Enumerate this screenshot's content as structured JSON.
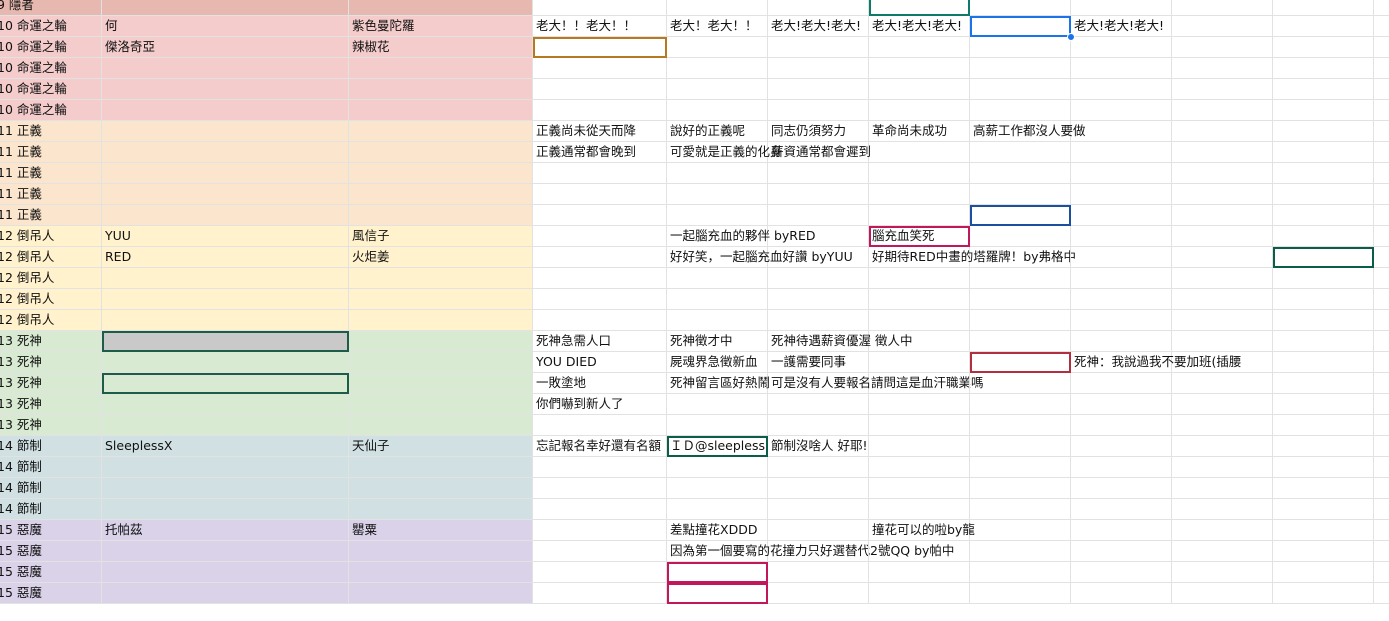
{
  "colors": {
    "hermit": "#e6b8af",
    "wheel": "#f4cccc",
    "justice": "#fce5cd",
    "hanged": "#fff2cc",
    "death": "#d9ead3",
    "temperance": "#d0e0e3",
    "devil": "#d9d2e9",
    "grid": "#e2e2e2",
    "selection_blue": "#1a73e8"
  },
  "rows": [
    {
      "group": "hermit",
      "cells": [
        "9 隱者",
        "",
        "",
        "",
        "",
        "",
        "",
        "",
        "",
        "",
        "",
        ""
      ]
    },
    {
      "group": "wheel",
      "cells": [
        "10 命運之輪",
        "何",
        "紫色曼陀羅",
        "老大！！老大！！",
        "老大！老大！！",
        "老大!老大!老大!",
        "老大!老大!老大!",
        "",
        "老大!老大!老大!",
        "",
        "",
        ""
      ]
    },
    {
      "group": "wheel",
      "cells": [
        "10 命運之輪",
        "傑洛奇亞",
        "辣椒花",
        "",
        "",
        "",
        "",
        "",
        "",
        "",
        "",
        ""
      ]
    },
    {
      "group": "wheel",
      "cells": [
        "10 命運之輪",
        "",
        "",
        "",
        "",
        "",
        "",
        "",
        "",
        "",
        "",
        ""
      ]
    },
    {
      "group": "wheel",
      "cells": [
        "10 命運之輪",
        "",
        "",
        "",
        "",
        "",
        "",
        "",
        "",
        "",
        "",
        ""
      ]
    },
    {
      "group": "wheel",
      "cells": [
        "10 命運之輪",
        "",
        "",
        "",
        "",
        "",
        "",
        "",
        "",
        "",
        "",
        ""
      ]
    },
    {
      "group": "justice",
      "cells": [
        "11 正義",
        "",
        "",
        "正義尚未從天而降",
        "說好的正義呢",
        "同志仍須努力",
        "革命尚未成功",
        "高薪工作都沒人要做",
        "",
        "",
        "",
        ""
      ]
    },
    {
      "group": "justice",
      "cells": [
        "11 正義",
        "",
        "",
        "正義通常都會晚到",
        "可愛就是正義的化身",
        "薪資通常都會遲到",
        "",
        "",
        "",
        "",
        "",
        ""
      ]
    },
    {
      "group": "justice",
      "cells": [
        "11 正義",
        "",
        "",
        "",
        "",
        "",
        "",
        "",
        "",
        "",
        "",
        ""
      ]
    },
    {
      "group": "justice",
      "cells": [
        "11 正義",
        "",
        "",
        "",
        "",
        "",
        "",
        "",
        "",
        "",
        "",
        ""
      ]
    },
    {
      "group": "justice",
      "cells": [
        "11 正義",
        "",
        "",
        "",
        "",
        "",
        "",
        "",
        "",
        "",
        "",
        ""
      ]
    },
    {
      "group": "hanged",
      "cells": [
        "12 倒吊人",
        "YUU",
        "風信子",
        "",
        "一起腦充血的夥伴 byRED",
        "",
        "腦充血笑死",
        "",
        "",
        "",
        "",
        ""
      ]
    },
    {
      "group": "hanged",
      "cells": [
        "12 倒吊人",
        "RED",
        "火炬姜",
        "",
        "好好笑，一起腦充血好讚 byYUU",
        "",
        "好期待RED中畫的塔羅牌！by弗格中",
        "",
        "",
        "",
        "",
        ""
      ]
    },
    {
      "group": "hanged",
      "cells": [
        "12 倒吊人",
        "",
        "",
        "",
        "",
        "",
        "",
        "",
        "",
        "",
        "",
        ""
      ]
    },
    {
      "group": "hanged",
      "cells": [
        "12 倒吊人",
        "",
        "",
        "",
        "",
        "",
        "",
        "",
        "",
        "",
        "",
        ""
      ]
    },
    {
      "group": "hanged",
      "cells": [
        "12 倒吊人",
        "",
        "",
        "",
        "",
        "",
        "",
        "",
        "",
        "",
        "",
        ""
      ]
    },
    {
      "group": "death",
      "cells": [
        "13 死神",
        "",
        "",
        "死神急需人口",
        "死神徵才中",
        "死神待遇薪資優渥 徵人中",
        "",
        "",
        "",
        "",
        "",
        ""
      ]
    },
    {
      "group": "death",
      "cells": [
        "13 死神",
        "",
        "",
        "YOU DIED",
        "屍魂界急徵新血",
        "一護需要同事",
        "",
        "",
        "死神：我說過我不要加班(插腰",
        "",
        "",
        ""
      ]
    },
    {
      "group": "death",
      "cells": [
        "13 死神",
        "",
        "",
        "一敗塗地",
        "死神留言區好熱鬧",
        "可是沒有人要報名請問這是血汗職業嗎",
        "",
        "",
        "",
        "",
        "",
        ""
      ]
    },
    {
      "group": "death",
      "cells": [
        "13 死神",
        "",
        "",
        "你們嚇到新人了",
        "",
        "",
        "",
        "",
        "",
        "",
        "",
        ""
      ]
    },
    {
      "group": "death",
      "cells": [
        "13 死神",
        "",
        "",
        "",
        "",
        "",
        "",
        "",
        "",
        "",
        "",
        ""
      ]
    },
    {
      "group": "temperance",
      "cells": [
        "14 節制",
        "SleeplessX",
        "天仙子",
        "忘記報名幸好還有名額",
        "ＩＤ@sleepless",
        "節制沒啥人 好耶!",
        "",
        "",
        "",
        "",
        "",
        ""
      ]
    },
    {
      "group": "temperance",
      "cells": [
        "14 節制",
        "",
        "",
        "",
        "",
        "",
        "",
        "",
        "",
        "",
        "",
        ""
      ]
    },
    {
      "group": "temperance",
      "cells": [
        "14 節制",
        "",
        "",
        "",
        "",
        "",
        "",
        "",
        "",
        "",
        "",
        ""
      ]
    },
    {
      "group": "temperance",
      "cells": [
        "14 節制",
        "",
        "",
        "",
        "",
        "",
        "",
        "",
        "",
        "",
        "",
        ""
      ]
    },
    {
      "group": "devil",
      "cells": [
        "15 惡魔",
        "托帕茲",
        "罌粟",
        "",
        "差點撞花XDDD",
        "",
        "撞花可以的啦by龍",
        "",
        "",
        "",
        "",
        ""
      ]
    },
    {
      "group": "devil",
      "cells": [
        "15 惡魔",
        "",
        "",
        "",
        "因為第一個要寫的花撞力只好選替代2號QQ  by帕中",
        "",
        "",
        "",
        "",
        "",
        "",
        ""
      ]
    },
    {
      "group": "devil",
      "cells": [
        "15 惡魔",
        "",
        "",
        "",
        "",
        "",
        "",
        "",
        "",
        "",
        "",
        ""
      ]
    },
    {
      "group": "devil",
      "cells": [
        "15 惡魔",
        "",
        "",
        "",
        "",
        "",
        "",
        "",
        "",
        "",
        "",
        ""
      ]
    }
  ]
}
